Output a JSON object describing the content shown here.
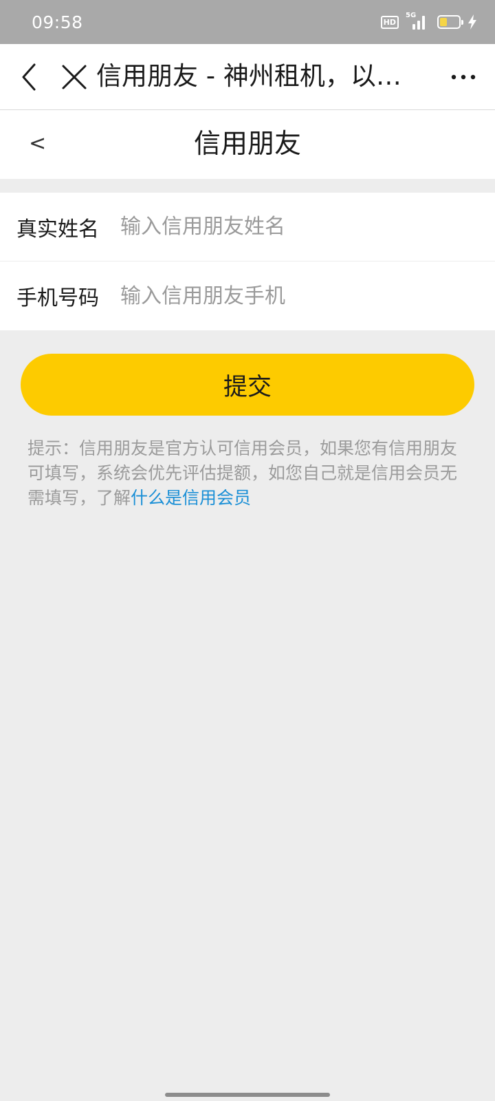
{
  "status_bar": {
    "time": "09:58",
    "hd_label": "HD",
    "network_label": "5G",
    "battery_level": 0.4,
    "icons": [
      "hd-icon",
      "signal-icon",
      "battery-icon",
      "charging-icon"
    ]
  },
  "browser": {
    "back_icon": "chevron-left-icon",
    "close_icon": "close-icon",
    "title": "信用朋友 - 神州租机，以租…",
    "more_icon": "more-dots-icon"
  },
  "page": {
    "back_label": "<",
    "title": "信用朋友"
  },
  "form": {
    "name_label": "真实姓名",
    "name_placeholder": "输入信用朋友姓名",
    "name_value": "",
    "phone_label": "手机号码",
    "phone_placeholder": "输入信用朋友手机",
    "phone_value": ""
  },
  "submit_label": "提交",
  "hint": {
    "text": "提示：信用朋友是官方认可信用会员，如果您有信用朋友可填写，系统会优先评估提额，如您自己就是信用会员无需填写，了解",
    "link": "什么是信用会员"
  },
  "colors": {
    "accent": "#fdcb00",
    "link": "#1a8fd6",
    "background": "#ededed",
    "status_bar": "#a9a9a9"
  }
}
